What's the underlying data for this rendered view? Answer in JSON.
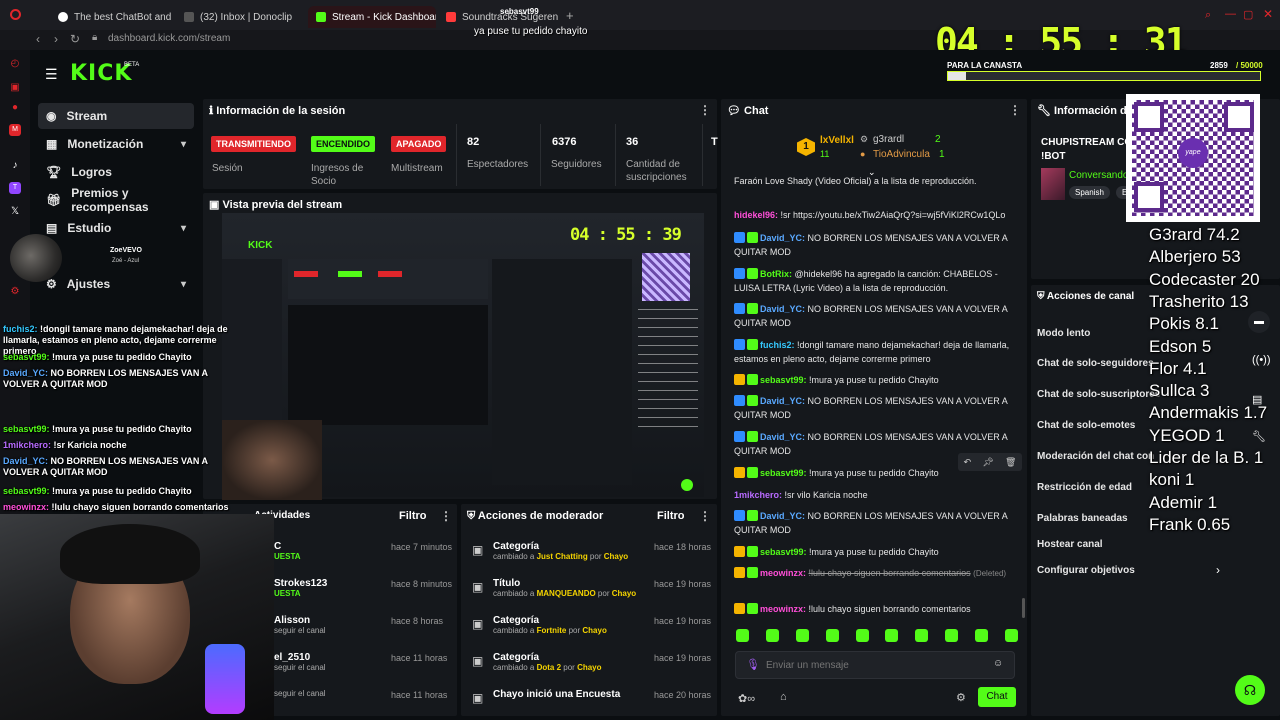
{
  "browser": {
    "tabs": [
      {
        "label": "The best ChatBot and",
        "color": "#ffffff"
      },
      {
        "label": "(32) Inbox | Donoclip",
        "color": "#b7b7b7"
      },
      {
        "label": "Stream - Kick Dashboard",
        "color": "#53fc18"
      },
      {
        "label": "Soundtracks Sugerencias",
        "color": "#ff3b3b"
      }
    ],
    "url": "dashboard.kick.com/stream",
    "overlay_tab_user": "sebasvt99"
  },
  "overlay": {
    "caption": "ya puse tu pedido chayito",
    "timer": "04 : 55 : 31",
    "goal_label": "PARA LA CANASTA",
    "goal_current": "2859",
    "goal_target": "/ 50000",
    "goal_fraction": 0.057,
    "webcam_name": "ZoeVEVO",
    "webcam_sub": "Zoé - Azul",
    "ranking": [
      "G3rard 74.2",
      "Alberjero 53",
      "Codecaster 20",
      "Trasherito 13",
      "Pokis 8.1",
      "Edson 5",
      "Flor 4.1",
      "Sullca 3",
      "Andermakis 1.7",
      "YEGOD 1",
      "Lider de la B. 1",
      "koni 1",
      "Ademir 1",
      "Frank 0.65"
    ],
    "chat_overlay": [
      {
        "user": "fuchis2:",
        "text": "!dongil tamare mano dejamekachar! deja de llamarla, estamos en pleno acto, dejame correrme primero",
        "color": "#35c9ff"
      },
      {
        "user": "sebasvt99:",
        "text": "!mura ya puse tu pedido Chayito",
        "color": "#53fc18"
      },
      {
        "user": "David_YC:",
        "text": "NO BORREN LOS MENSAJES VAN A VOLVER A QUITAR MOD",
        "color": "#5aa9ff"
      },
      {
        "user": "sebasvt99:",
        "text": "!mura ya puse tu pedido Chayito",
        "color": "#53fc18"
      },
      {
        "user": "1mikchero:",
        "text": "!sr Karicia noche",
        "color": "#b86bff"
      },
      {
        "user": "David_YC:",
        "text": "NO BORREN LOS MENSAJES VAN A VOLVER A QUITAR MOD",
        "color": "#5aa9ff"
      },
      {
        "user": "sebasvt99:",
        "text": "!mura ya puse tu pedido Chayito",
        "color": "#53fc18"
      },
      {
        "user": "meowinzx:",
        "text": "!lulu chayo siguen borrando comentarios",
        "color": "#ff4fd8"
      }
    ]
  },
  "kick": {
    "logo": "KICK",
    "beta": "BETA",
    "sidebar": [
      {
        "label": "Stream",
        "icon": "stream-icon",
        "active": true
      },
      {
        "label": "Monetización",
        "icon": "monetization-icon",
        "chevron": true
      },
      {
        "label": "Logros",
        "icon": "trophy-icon"
      },
      {
        "label": "Premios y recompensas",
        "icon": "gift-icon"
      },
      {
        "label": "Estudio",
        "icon": "studio-icon",
        "chevron": true
      },
      {
        "label": "Ajustes",
        "icon": "settings-icon",
        "chevron": true
      }
    ],
    "session": {
      "title": "Información de la sesión",
      "badges": [
        {
          "label": "TRANSMITIENDO",
          "caption": "Sesión",
          "bg": "#e0262b"
        },
        {
          "label": "ENCENDIDO",
          "caption": "Ingresos de Socio",
          "bg": "#53fc18"
        },
        {
          "label": "APAGADO",
          "caption": "Multistream",
          "bg": "#e0262b"
        }
      ],
      "stats": [
        {
          "value": "82",
          "label": "Espectadores"
        },
        {
          "value": "6376",
          "label": "Seguidores"
        },
        {
          "value": "36",
          "label": "Cantidad de suscripciones"
        },
        {
          "value": "T",
          "label": ""
        }
      ]
    },
    "preview": {
      "title": "Vista previa del stream",
      "timer": "04 : 55 : 39"
    },
    "activity": {
      "title": "Actividades",
      "filter": "Filtro",
      "rows": [
        {
          "name": "C",
          "sub": "UESTA",
          "time": "hace 7 minutos"
        },
        {
          "name": "Strokes123",
          "sub": "UESTA",
          "time": "hace 8 minutos"
        },
        {
          "name": "Alisson",
          "sub": "seguir el canal",
          "time": "hace 8 horas"
        },
        {
          "name": "el_2510",
          "sub": "seguir el canal",
          "time": "hace 11 horas"
        },
        {
          "name": "",
          "sub": "seguir el canal",
          "time": "hace 11 horas"
        }
      ]
    },
    "mod_actions": {
      "title": "Acciones de moderador",
      "filter": "Filtro",
      "rows": [
        {
          "title": "Categoría",
          "sub_pre": "cambiado a ",
          "sub_val": "Just Chatting",
          "sub_by": " por ",
          "sub_user": "Chayo",
          "time": "hace 18 horas"
        },
        {
          "title": "Título",
          "sub_pre": "cambiado a ",
          "sub_val": "MANQUEANDO",
          "sub_by": " por ",
          "sub_user": "Chayo",
          "time": "hace 19 horas"
        },
        {
          "title": "Categoría",
          "sub_pre": "cambiado a ",
          "sub_val": "Fortnite",
          "sub_by": " por ",
          "sub_user": "Chayo",
          "time": "hace 19 horas"
        },
        {
          "title": "Categoría",
          "sub_pre": "cambiado a ",
          "sub_val": "Dota 2",
          "sub_by": " por ",
          "sub_user": "Chayo",
          "time": "hace 19 horas"
        },
        {
          "title": "Chayo inició una Encuesta",
          "sub_pre": "",
          "sub_val": "",
          "sub_by": "",
          "sub_user": "",
          "time": "hace 20 horas"
        }
      ]
    },
    "chat": {
      "title": "Chat",
      "leaderboard": [
        {
          "rank": "1",
          "user": "lxVellxl",
          "count": "11"
        },
        {
          "rank": "",
          "user": "g3rardl",
          "count": "2"
        },
        {
          "rank": "",
          "user": "TioAdvincula",
          "count": "1"
        }
      ],
      "messages": [
        {
          "user": "",
          "text": "Faraón Love Shady (Video Oficial) a la lista de reproducción.",
          "color": "#e6e6e6"
        },
        {
          "user": "hidekel96:",
          "text": "!sr https://youtu.be/xTiw2AiaQrQ?si=wj5fViKl2RCw1QLo",
          "color": "#ff4fd8"
        },
        {
          "user": "David_YC:",
          "text": "NO BORREN LOS MENSAJES VAN A VOLVER A QUITAR MOD",
          "color": "#5aa9ff"
        },
        {
          "user": "BotRix:",
          "text": "@hidekel96 ha agregado la canción: CHABELOS - LUISA LETRA (Lyric Video) a la lista de reproducción.",
          "color": "#53fc18"
        },
        {
          "user": "David_YC:",
          "text": "NO BORREN LOS MENSAJES VAN A VOLVER A QUITAR MOD",
          "color": "#5aa9ff"
        },
        {
          "user": "fuchis2:",
          "text": "!dongil tamare mano dejamekachar! deja de llamarla, estamos en pleno acto, dejame correrme primero",
          "color": "#35c9ff"
        },
        {
          "user": "sebasvt99:",
          "text": "!mura ya puse tu pedido Chayito",
          "color": "#53fc18"
        },
        {
          "user": "David_YC:",
          "text": "NO BORREN LOS MENSAJES VAN A VOLVER A QUITAR MOD",
          "color": "#5aa9ff"
        },
        {
          "user": "David_YC:",
          "text": "NO BORREN LOS MENSAJES VAN A VOLVER A QUITAR MOD",
          "color": "#5aa9ff"
        },
        {
          "user": "sebasvt99:",
          "text": "!mura ya puse tu pedido Chayito",
          "color": "#53fc18"
        },
        {
          "user": "1mikchero:",
          "text": "!sr vilo Karicia noche",
          "color": "#b86bff"
        },
        {
          "user": "David_YC:",
          "text": "NO BORREN LOS MENSAJES VAN A VOLVER A QUITAR MOD",
          "color": "#5aa9ff"
        },
        {
          "user": "sebasvt99:",
          "text": "!mura ya puse tu pedido Chayito",
          "color": "#53fc18"
        },
        {
          "user": "meowinzx:",
          "text": "!lulu chayo siguen borrando comentarios",
          "color": "#ff4fd8",
          "deleted": "(Deleted)"
        },
        {
          "user": "meowinzx:",
          "text": "!lulu chayo siguen borrando comentarios",
          "color": "#ff4fd8"
        }
      ],
      "input_placeholder": "Enviar un mensaje",
      "send_label": "Chat"
    },
    "channel_info": {
      "title": "Información del s",
      "stream_title": "CHUPISTREAM CO",
      "stream_title2": "!BOT",
      "category": "Conversando",
      "tag_lang": "Spanish",
      "tag_extra": "E"
    },
    "channel_actions": {
      "title": "Acciones de canal",
      "items": [
        "Modo lento",
        "Chat de solo-seguidores",
        "Chat de solo-suscriptores",
        "Chat de solo-emotes",
        "Moderación del chat con",
        "Restricción de edad",
        "Palabras baneadas",
        "Hostear canal",
        "Configurar objetivos"
      ]
    }
  }
}
